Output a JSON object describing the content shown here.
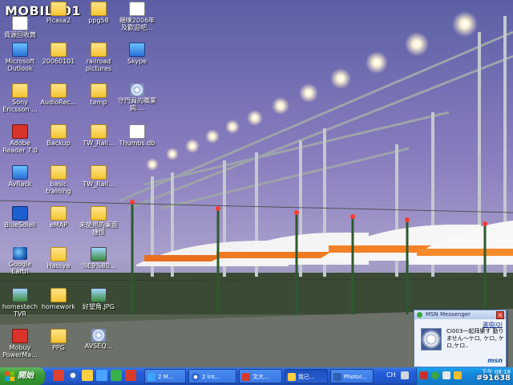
{
  "logo": {
    "text": "MOBILE01"
  },
  "desktop": {
    "icons": [
      {
        "label": "資源回收筒",
        "kind": "doc"
      },
      {
        "label": "Picasa2",
        "kind": "folder"
      },
      {
        "label": "ppg58",
        "kind": "folder"
      },
      {
        "label": "親噗2006年及歡迎吧...",
        "kind": "doc"
      },
      {
        "label": "Microsoft Outlook",
        "kind": "app"
      },
      {
        "label": "20060101",
        "kind": "folder"
      },
      {
        "label": "railroad pictures",
        "kind": "folder"
      },
      {
        "label": "Skype",
        "kind": "app"
      },
      {
        "label": "Sony Ericsson ...",
        "kind": "folder"
      },
      {
        "label": "AudioRec...",
        "kind": "folder"
      },
      {
        "label": "temp",
        "kind": "folder"
      },
      {
        "label": "守門員的職業病....",
        "kind": "cd"
      },
      {
        "label": "Adobe Reader 7.0",
        "kind": "red"
      },
      {
        "label": "Backup",
        "kind": "folder"
      },
      {
        "label": "TW_Rail...",
        "kind": "folder"
      },
      {
        "label": "Thumbs.db",
        "kind": "doc"
      },
      {
        "label": "AvRack",
        "kind": "app"
      },
      {
        "label": "basic training",
        "kind": "folder"
      },
      {
        "label": "TW_Rail...",
        "kind": "folder"
      },
      {
        "label": "BlueSoleil",
        "kind": "bt"
      },
      {
        "label": "eMAP",
        "kind": "folder"
      },
      {
        "label": "未使用的桌面捷徑",
        "kind": "folder"
      },
      {
        "label": "Google Earth",
        "kind": "globe"
      },
      {
        "label": "Hassya",
        "kind": "folder"
      },
      {
        "label": "%E9%80...",
        "kind": "img"
      },
      {
        "label": "homestech TVR",
        "kind": "img"
      },
      {
        "label": "homework",
        "kind": "folder"
      },
      {
        "label": "好望角.JPG",
        "kind": "img"
      },
      {
        "label": "Mobuy PowerMa...",
        "kind": "red"
      },
      {
        "label": "PPG",
        "kind": "folder"
      },
      {
        "label": "AVSEQ...",
        "kind": "cd"
      }
    ]
  },
  "msn": {
    "title": "MSN Messenger",
    "close": "×",
    "options": "選項(Q)",
    "message": "CI003一起拜樂す 勤りません～ケロ, ケロ, ケロ,ケロ..",
    "brand": "msn"
  },
  "taskbar": {
    "start_label": "開始",
    "tasks": [
      {
        "label": "2 M..."
      },
      {
        "label": "2 Int..."
      },
      {
        "label": "文大..."
      },
      {
        "label": "我已..."
      },
      {
        "label": "PhotoI..."
      }
    ],
    "ime": "CH",
    "clock": "下午 08:18",
    "watermark": "#91638"
  },
  "colors": {
    "taskbar": "#245edb",
    "start": "#3a9b36",
    "tray": "#1488d9"
  }
}
